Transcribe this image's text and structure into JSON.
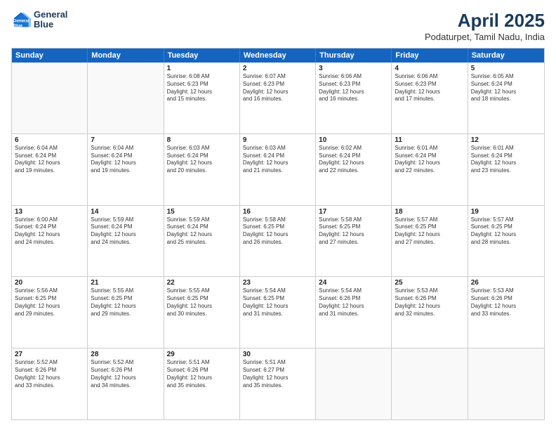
{
  "header": {
    "logo_line1": "General",
    "logo_line2": "Blue",
    "title": "April 2025",
    "subtitle": "Podaturpet, Tamil Nadu, India"
  },
  "days_of_week": [
    "Sunday",
    "Monday",
    "Tuesday",
    "Wednesday",
    "Thursday",
    "Friday",
    "Saturday"
  ],
  "weeks": [
    [
      {
        "day": "",
        "info": ""
      },
      {
        "day": "",
        "info": ""
      },
      {
        "day": "1",
        "info": "Sunrise: 6:08 AM\nSunset: 6:23 PM\nDaylight: 12 hours\nand 15 minutes."
      },
      {
        "day": "2",
        "info": "Sunrise: 6:07 AM\nSunset: 6:23 PM\nDaylight: 12 hours\nand 16 minutes."
      },
      {
        "day": "3",
        "info": "Sunrise: 6:06 AM\nSunset: 6:23 PM\nDaylight: 12 hours\nand 16 minutes."
      },
      {
        "day": "4",
        "info": "Sunrise: 6:06 AM\nSunset: 6:23 PM\nDaylight: 12 hours\nand 17 minutes."
      },
      {
        "day": "5",
        "info": "Sunrise: 6:05 AM\nSunset: 6:24 PM\nDaylight: 12 hours\nand 18 minutes."
      }
    ],
    [
      {
        "day": "6",
        "info": "Sunrise: 6:04 AM\nSunset: 6:24 PM\nDaylight: 12 hours\nand 19 minutes."
      },
      {
        "day": "7",
        "info": "Sunrise: 6:04 AM\nSunset: 6:24 PM\nDaylight: 12 hours\nand 19 minutes."
      },
      {
        "day": "8",
        "info": "Sunrise: 6:03 AM\nSunset: 6:24 PM\nDaylight: 12 hours\nand 20 minutes."
      },
      {
        "day": "9",
        "info": "Sunrise: 6:03 AM\nSunset: 6:24 PM\nDaylight: 12 hours\nand 21 minutes."
      },
      {
        "day": "10",
        "info": "Sunrise: 6:02 AM\nSunset: 6:24 PM\nDaylight: 12 hours\nand 22 minutes."
      },
      {
        "day": "11",
        "info": "Sunrise: 6:01 AM\nSunset: 6:24 PM\nDaylight: 12 hours\nand 22 minutes."
      },
      {
        "day": "12",
        "info": "Sunrise: 6:01 AM\nSunset: 6:24 PM\nDaylight: 12 hours\nand 23 minutes."
      }
    ],
    [
      {
        "day": "13",
        "info": "Sunrise: 6:00 AM\nSunset: 6:24 PM\nDaylight: 12 hours\nand 24 minutes."
      },
      {
        "day": "14",
        "info": "Sunrise: 5:59 AM\nSunset: 6:24 PM\nDaylight: 12 hours\nand 24 minutes."
      },
      {
        "day": "15",
        "info": "Sunrise: 5:59 AM\nSunset: 6:24 PM\nDaylight: 12 hours\nand 25 minutes."
      },
      {
        "day": "16",
        "info": "Sunrise: 5:58 AM\nSunset: 6:25 PM\nDaylight: 12 hours\nand 26 minutes."
      },
      {
        "day": "17",
        "info": "Sunrise: 5:58 AM\nSunset: 6:25 PM\nDaylight: 12 hours\nand 27 minutes."
      },
      {
        "day": "18",
        "info": "Sunrise: 5:57 AM\nSunset: 6:25 PM\nDaylight: 12 hours\nand 27 minutes."
      },
      {
        "day": "19",
        "info": "Sunrise: 5:57 AM\nSunset: 6:25 PM\nDaylight: 12 hours\nand 28 minutes."
      }
    ],
    [
      {
        "day": "20",
        "info": "Sunrise: 5:56 AM\nSunset: 6:25 PM\nDaylight: 12 hours\nand 29 minutes."
      },
      {
        "day": "21",
        "info": "Sunrise: 5:55 AM\nSunset: 6:25 PM\nDaylight: 12 hours\nand 29 minutes."
      },
      {
        "day": "22",
        "info": "Sunrise: 5:55 AM\nSunset: 6:25 PM\nDaylight: 12 hours\nand 30 minutes."
      },
      {
        "day": "23",
        "info": "Sunrise: 5:54 AM\nSunset: 6:25 PM\nDaylight: 12 hours\nand 31 minutes."
      },
      {
        "day": "24",
        "info": "Sunrise: 5:54 AM\nSunset: 6:26 PM\nDaylight: 12 hours\nand 31 minutes."
      },
      {
        "day": "25",
        "info": "Sunrise: 5:53 AM\nSunset: 6:26 PM\nDaylight: 12 hours\nand 32 minutes."
      },
      {
        "day": "26",
        "info": "Sunrise: 5:53 AM\nSunset: 6:26 PM\nDaylight: 12 hours\nand 33 minutes."
      }
    ],
    [
      {
        "day": "27",
        "info": "Sunrise: 5:52 AM\nSunset: 6:26 PM\nDaylight: 12 hours\nand 33 minutes."
      },
      {
        "day": "28",
        "info": "Sunrise: 5:52 AM\nSunset: 6:26 PM\nDaylight: 12 hours\nand 34 minutes."
      },
      {
        "day": "29",
        "info": "Sunrise: 5:51 AM\nSunset: 6:26 PM\nDaylight: 12 hours\nand 35 minutes."
      },
      {
        "day": "30",
        "info": "Sunrise: 5:51 AM\nSunset: 6:27 PM\nDaylight: 12 hours\nand 35 minutes."
      },
      {
        "day": "",
        "info": ""
      },
      {
        "day": "",
        "info": ""
      },
      {
        "day": "",
        "info": ""
      }
    ]
  ]
}
